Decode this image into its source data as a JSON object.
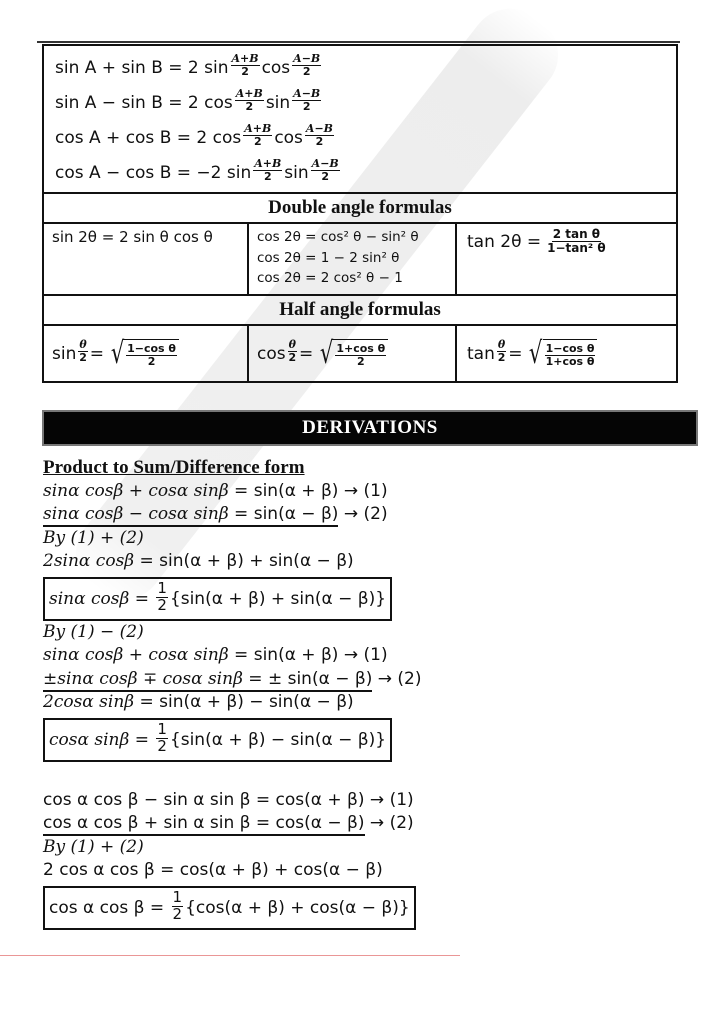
{
  "sum_to_product": [
    {
      "lhs": "sin A + sin B = 2 sin",
      "f1": {
        "num": "A+B",
        "den": "2"
      },
      "mid": "cos",
      "f2": {
        "num": "A−B",
        "den": "2"
      }
    },
    {
      "lhs": "sin A − sin B = 2 cos",
      "f1": {
        "num": "A+B",
        "den": "2"
      },
      "mid": "sin",
      "f2": {
        "num": "A−B",
        "den": "2"
      }
    },
    {
      "lhs": "cos A + cos B = 2 cos",
      "f1": {
        "num": "A+B",
        "den": "2"
      },
      "mid": "cos",
      "f2": {
        "num": "A−B",
        "den": "2"
      }
    },
    {
      "lhs": "cos A − cos B = −2 sin",
      "f1": {
        "num": "A+B",
        "den": "2"
      },
      "mid": "sin",
      "f2": {
        "num": "A−B",
        "den": "2"
      }
    }
  ],
  "double_angle": {
    "title": "Double angle formulas",
    "sin": "sin 2θ = 2 sin θ cos θ",
    "cos": [
      "cos 2θ = cos² θ − sin² θ",
      "cos 2θ = 1 − 2 sin² θ",
      "cos 2θ = 2 cos² θ − 1"
    ],
    "tan": {
      "lhs": "tan 2θ =",
      "num": "2 tan θ",
      "den": "1−tan² θ"
    }
  },
  "half_angle": {
    "title": "Half angle formulas",
    "items": [
      {
        "fn": "sin",
        "half_num": "θ",
        "half_den": "2",
        "eq": "=",
        "num": "1−cos θ",
        "den": "2"
      },
      {
        "fn": "cos",
        "half_num": "θ",
        "half_den": "2",
        "eq": "=",
        "num": "1+cos θ",
        "den": "2"
      },
      {
        "fn": "tan",
        "half_num": "θ",
        "half_den": "2",
        "eq": "=",
        "num": "1−cos θ",
        "den": "1+cos θ"
      }
    ]
  },
  "derivations": {
    "bar_title": "DERIVATIONS",
    "heading": "Product to Sum/Difference form",
    "block1": {
      "eq1": {
        "lhs": "sinα cosβ + cosα sinβ",
        "rhs": " = sin(α + β)",
        "tag": " → (1)"
      },
      "eq2": {
        "lhs": "sinα cosβ −  cosα sinβ",
        "rhs": " = sin(α − β)",
        "tag": " → (2)"
      },
      "by": "By (1) + (2)",
      "result": {
        "lhs": "2sinα cosβ",
        "rhs": " = sin(α + β) + sin(α − β)"
      },
      "boxed": {
        "lhs": "sinα cosβ = ",
        "num": "1",
        "den": "2",
        "rhs": "{sin(α + β) + sin(α − β)}"
      }
    },
    "block2": {
      "by": "By (1) − (2)",
      "eq1": {
        "lhs": "sinα cosβ + cosα sinβ",
        "rhs": " = sin(α + β)",
        "tag": " → (1)"
      },
      "eq2": {
        "lhs": "±sinα cosβ ∓  cosα sinβ",
        "rhs": " = ± sin(α − β)",
        "tag": " → (2)"
      },
      "result": {
        "lhs": "2cosα sinβ",
        "rhs": " = sin(α + β) − sin(α − β)"
      },
      "boxed": {
        "lhs": "cosα sinβ = ",
        "num": "1",
        "den": "2",
        "rhs": "{sin(α + β) − sin(α − β)}"
      }
    },
    "block3": {
      "eq1": {
        "text": "cos α cos β − sin α sin β = cos(α + β)",
        "tag": " → (1)"
      },
      "eq2": {
        "text": "cos α cos β + sin α sin β = cos(α − β)",
        "tag": " → (2)"
      },
      "by": "By (1) + (2)",
      "result": "2 cos α cos β = cos(α + β) + cos(α − β)",
      "boxed": {
        "lhs": "cos α cos β = ",
        "num": "1",
        "den": "2",
        "rhs": "{cos(α + β) + cos(α − β)}"
      }
    }
  }
}
